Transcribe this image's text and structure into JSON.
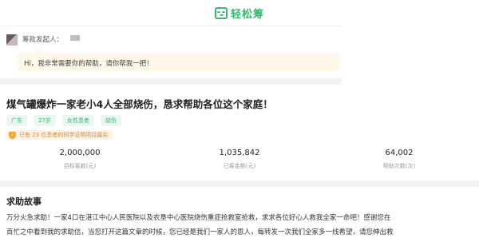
{
  "header": {
    "logo_text": "轻松筹"
  },
  "sponsor": {
    "label": "筹款发起人：",
    "message": "Hi，我非常需要你的帮助，请你帮我一把！"
  },
  "project": {
    "title": "煤气罐爆炸一家老小4人全部烧伤，恳求帮助各位这个家庭！",
    "tags": [
      "广东",
      "27岁",
      "女性患者",
      "烧伤"
    ],
    "verify_text": "已有 23 位患者的同学证明项目属实",
    "stats": [
      {
        "value": "2,000,000",
        "label": "目标筹款(元)"
      },
      {
        "value": "1,035,842",
        "label": "已筹金额(元)"
      },
      {
        "value": "64,002",
        "label": "帮助次数(次)"
      }
    ]
  },
  "story": {
    "heading": "求助故事",
    "line1": "万分火急求助！一家4口在湛江中心人民医院以及农垦中心医院烧伤重症抢救室抢救，求求各位好心人救我全家一命吧！感谢您在",
    "line2": "百忙之中看到我的求助信，当您打开这篇文章的时候，您已经是我们一家人的恩人，每转发一次我们全家多一线希望，请您伸出救"
  },
  "colors": {
    "brand": "#35b86b",
    "bubble": "#fff7e8",
    "verify": "#f5a623"
  }
}
